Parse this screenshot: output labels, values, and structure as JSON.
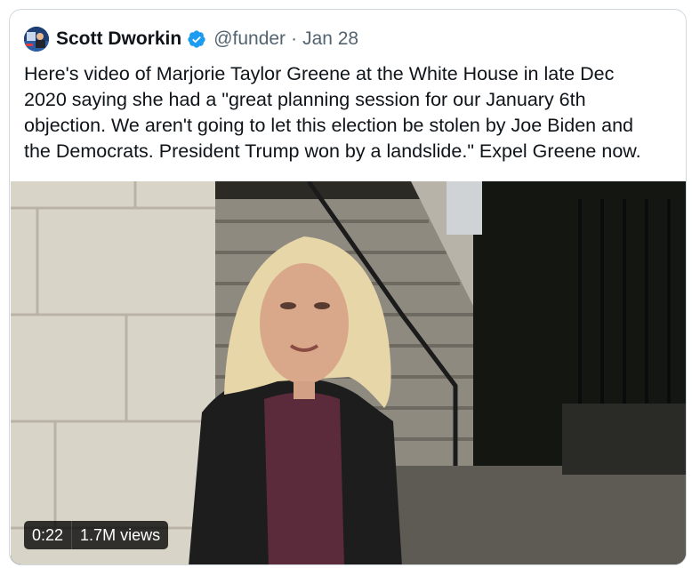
{
  "tweet": {
    "author": {
      "display_name": "Scott Dworkin",
      "handle": "@funder",
      "verified": true,
      "avatar_icon": "profile-photo"
    },
    "separator": "·",
    "date": "Jan 28",
    "text_lines": [
      "Here's video of Marjorie Taylor Greene at the White House in late Dec",
      "2020 saying she had a \"great planning session for our January 6th",
      "objection. We aren't going to let this election be stolen by Joe Biden and",
      "the Democrats. President Trump won by a landslide.\" Expel Greene now."
    ]
  },
  "video": {
    "duration": "0:22",
    "views": "1.7M views"
  },
  "colors": {
    "verified_blue": "#1d9bf0",
    "secondary_text": "#536471",
    "border": "#cfd9de"
  }
}
